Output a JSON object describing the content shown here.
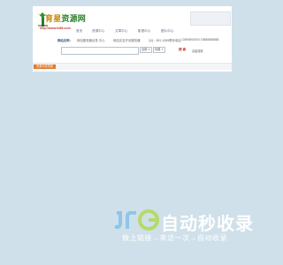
{
  "header": {
    "logo_text_a": "育星",
    "logo_text_b": "资源网",
    "logo_url": "http://www.hi88.com",
    "colors": {
      "logo_brown": "#c98a10",
      "logo_green": "#2d7f2a",
      "accent_red": "#c0392b"
    }
  },
  "nav": [
    {
      "label": "首页"
    },
    {
      "label": "资源中心"
    },
    {
      "label": "文章中心"
    },
    {
      "label": "影视中心"
    },
    {
      "label": "图片中心"
    }
  ],
  "info": {
    "label": "网站名称：",
    "items": [
      "网站服务器出售  中心",
      "网站实名开设服务器",
      "QQ：891-1089",
      "联系电话",
      "13590800000  15888888888"
    ]
  },
  "search": {
    "placeholder": "",
    "category_select": "全部",
    "type_select": "标题",
    "button_label": "搜 索",
    "advanced_label": "高级搜索"
  },
  "bottom": {
    "tag_label": "资源分类导航"
  },
  "watermark": {
    "title": "自动秒收录",
    "subtitle": "做上链接→来访一次→自动收录",
    "colors": {
      "logo_blue": "#8ec6e8",
      "logo_green": "#b6da6a"
    }
  }
}
